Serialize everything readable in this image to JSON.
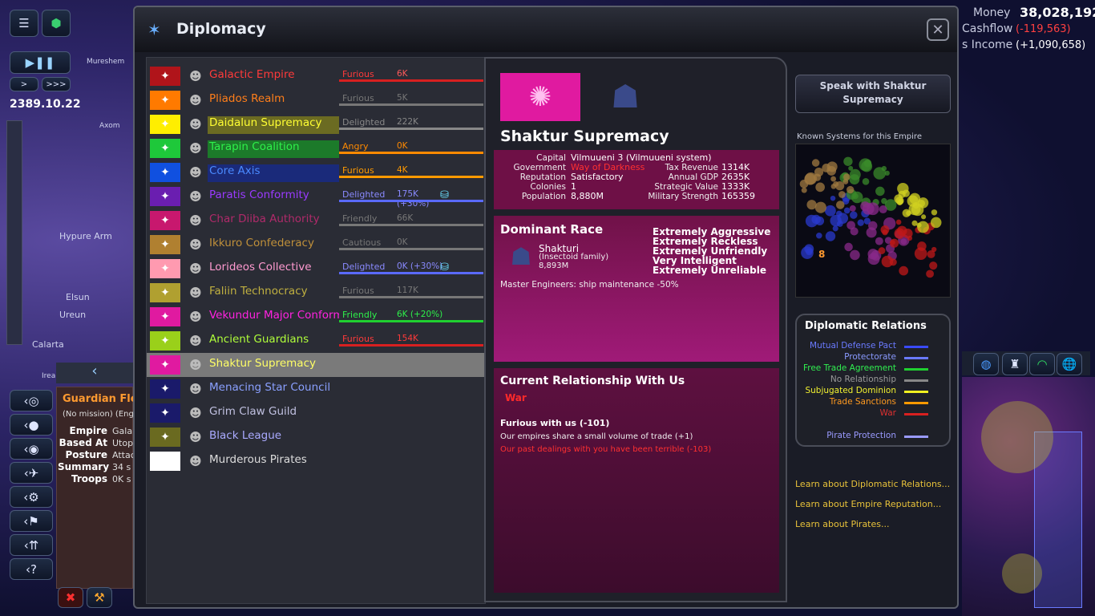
{
  "hud": {
    "date": "2389.10.22",
    "map_labels": [
      "Hypure Arm",
      "Calarta",
      "Elsun",
      "Ureun",
      "Mureshem",
      "Axom",
      "Ireab"
    ],
    "money_label": "Money",
    "money_value": "38,028,192",
    "cashflow_label": "Cashflow",
    "cashflow_value": "(-119,563)",
    "income_label": "s Income",
    "income_value": "(+1,090,658)",
    "speed_slow": ">",
    "speed_fast": ">>>"
  },
  "fleet": {
    "title": "Guardian Fle",
    "mission": "(No mission) (Eng",
    "rows": [
      {
        "label": "Empire",
        "value": "Gala"
      },
      {
        "label": "Based At",
        "value": "Utop"
      },
      {
        "label": "Posture",
        "value": "Attac"
      },
      {
        "label": "Summary",
        "value": "34 s"
      },
      {
        "label": "Troops",
        "value": "0K s"
      }
    ]
  },
  "window": {
    "title": "Diplomacy",
    "close": "✕"
  },
  "empires": [
    {
      "name": "Galactic Empire",
      "attitude": "Furious",
      "value": "6K",
      "flag_color": "#b0141a",
      "name_color": "#ff3a3a",
      "name_bg": "",
      "attitude_color": "#ff3a3a",
      "value_color": "#ff5a5a",
      "bar_color": "#d82020",
      "bar_width": 180,
      "trade": false
    },
    {
      "name": "Pliados Realm",
      "attitude": "Furious",
      "value": "5K",
      "flag_color": "#ff7a00",
      "name_color": "#ff7e1a",
      "name_bg": "",
      "attitude_color": "#777",
      "value_color": "#777",
      "bar_color": "#777",
      "bar_width": 180,
      "trade": false
    },
    {
      "name": "Daidalun Supremacy",
      "attitude": "Delighted",
      "value": "222K",
      "flag_color": "#ffee00",
      "name_color": "#ffff33",
      "name_bg": "#6b6b22",
      "attitude_color": "#888",
      "value_color": "#888",
      "bar_color": "#888",
      "bar_width": 180,
      "trade": false
    },
    {
      "name": "Tarapin Coalition",
      "attitude": "Angry",
      "value": "0K",
      "flag_color": "#1ec83a",
      "name_color": "#2ef04a",
      "name_bg": "#1c7a2a",
      "attitude_color": "#ff8a00",
      "value_color": "#ff8a00",
      "bar_color": "#ff8a00",
      "bar_width": 180,
      "trade": false
    },
    {
      "name": "Core Axis",
      "attitude": "Furious",
      "value": "4K",
      "flag_color": "#1050e0",
      "name_color": "#4a8aff",
      "name_bg": "#1a2a7a",
      "attitude_color": "#ff9a00",
      "value_color": "#ff9a00",
      "bar_color": "#ff9a00",
      "bar_width": 180,
      "trade": false
    },
    {
      "name": "Paratis Conformity",
      "attitude": "Delighted",
      "value": "175K (+30%)",
      "flag_color": "#6a1eb0",
      "name_color": "#9a3aff",
      "name_bg": "",
      "attitude_color": "#8a8aff",
      "value_color": "#8a8aff",
      "bar_color": "#5a6aff",
      "bar_width": 180,
      "trade": true
    },
    {
      "name": "Char Diiba Authority",
      "attitude": "Friendly",
      "value": "66K",
      "flag_color": "#c8186e",
      "name_color": "#b02a6a",
      "name_bg": "",
      "attitude_color": "#777",
      "value_color": "#777",
      "bar_color": "#777",
      "bar_width": 180,
      "trade": false
    },
    {
      "name": "Ikkuro Confederacy",
      "attitude": "Cautious",
      "value": "0K",
      "flag_color": "#b08030",
      "name_color": "#c0903a",
      "name_bg": "",
      "attitude_color": "#777",
      "value_color": "#777",
      "bar_color": "#777",
      "bar_width": 180,
      "trade": false
    },
    {
      "name": "Lorideos Collective",
      "attitude": "Delighted",
      "value": "0K (+30%)",
      "flag_color": "#ff9ab0",
      "name_color": "#ff9ad0",
      "name_bg": "",
      "attitude_color": "#8a8aff",
      "value_color": "#8a8aff",
      "bar_color": "#5a6aff",
      "bar_width": 180,
      "trade": true
    },
    {
      "name": "Faliin Technocracy",
      "attitude": "Furious",
      "value": "117K",
      "flag_color": "#b0a030",
      "name_color": "#c0b040",
      "name_bg": "",
      "attitude_color": "#777",
      "value_color": "#777",
      "bar_color": "#777",
      "bar_width": 180,
      "trade": false
    },
    {
      "name": "Vekundur Major Conformi",
      "attitude": "Friendly",
      "value": "6K (+20%)",
      "flag_color": "#e01aa0",
      "name_color": "#ff22e0",
      "name_bg": "",
      "attitude_color": "#2ef04a",
      "value_color": "#2ef04a",
      "bar_color": "#20d030",
      "bar_width": 180,
      "trade": false
    },
    {
      "name": "Ancient Guardians",
      "attitude": "Furious",
      "value": "154K",
      "flag_color": "#9ad01a",
      "name_color": "#b0ff3a",
      "name_bg": "",
      "attitude_color": "#ff3a3a",
      "value_color": "#ff3a3a",
      "bar_color": "#d82020",
      "bar_width": 180,
      "trade": false
    },
    {
      "name": "Shaktur Supremacy",
      "attitude": "",
      "value": "",
      "flag_color": "#e01aa0",
      "name_color": "#ffff66",
      "name_bg": "",
      "attitude_color": "#777",
      "value_color": "#777",
      "bar_color": "",
      "bar_width": 0,
      "trade": false,
      "selected": true
    },
    {
      "name": "Menacing Star Council",
      "attitude": "",
      "value": "",
      "flag_color": "#1a1a6a",
      "name_color": "#8aa0ff",
      "name_bg": "",
      "attitude_color": "#777",
      "value_color": "#777",
      "bar_color": "",
      "bar_width": 0,
      "trade": false
    },
    {
      "name": "Grim Claw Guild",
      "attitude": "",
      "value": "",
      "flag_color": "#1a1a6a",
      "name_color": "#c0c0e0",
      "name_bg": "",
      "attitude_color": "#777",
      "value_color": "#777",
      "bar_color": "",
      "bar_width": 0,
      "trade": false
    },
    {
      "name": "Black League",
      "attitude": "",
      "value": "",
      "flag_color": "#6a6a20",
      "name_color": "#aaaaff",
      "name_bg": "",
      "attitude_color": "#777",
      "value_color": "#777",
      "bar_color": "",
      "bar_width": 0,
      "trade": false
    },
    {
      "name": "Murderous Pirates",
      "attitude": "",
      "value": "",
      "flag_color": "#ffffff",
      "name_color": "#dddddd",
      "name_bg": "",
      "attitude_color": "#777",
      "value_color": "#777",
      "bar_color": "",
      "bar_width": 0,
      "trade": false
    }
  ],
  "detail": {
    "empire_name": "Shaktur Supremacy",
    "capital_label": "Capital",
    "capital_value": "Vilmuueni 3 (Vilmuueni system)",
    "government_label": "Government",
    "government_value": "Way of Darkness",
    "reputation_label": "Reputation",
    "reputation_value": "Satisfactory",
    "colonies_label": "Colonies",
    "colonies_value": "1",
    "population_label": "Population",
    "population_value": "8,880M",
    "tax_label": "Tax Revenue",
    "tax_value": "1314K",
    "gdp_label": "Annual GDP",
    "gdp_value": "2635K",
    "strategic_label": "Strategic Value",
    "strategic_value": "1333K",
    "military_label": "Military Strength",
    "military_value": "165359",
    "race_heading": "Dominant Race",
    "race_name": "Shakturi",
    "race_family": "(Insectoid family)",
    "race_pop": "8,893M",
    "traits": [
      "Extremely Aggressive",
      "Extremely Reckless",
      "Extremely Unfriendly",
      "Very Intelligent",
      "Extremely Unreliable"
    ],
    "race_bonus": "Master Engineers: ship maintenance -50%",
    "relation_heading": "Current Relationship With Us",
    "relation_status": "War",
    "mood": "Furious with us (-101)",
    "mood_items": [
      {
        "text": "Our empires share a small volume of trade (+1)",
        "color": "#f0f0f0"
      },
      {
        "text": "Our past dealings with you have been terrible (-103)",
        "color": "#ff3030"
      }
    ]
  },
  "right": {
    "speak_button": "Speak with Shaktur Supremacy",
    "known_systems_label": "Known Systems for this Empire",
    "relations_heading": "Diplomatic Relations",
    "legend": [
      {
        "label": "Mutual Defense Pact",
        "color": "#3a4aff",
        "text_color": "#6a7aff"
      },
      {
        "label": "Protectorate",
        "color": "#6a7aff",
        "text_color": "#8a9aff"
      },
      {
        "label": "Free Trade Agreement",
        "color": "#20d030",
        "text_color": "#30f050"
      },
      {
        "label": "No Relationship",
        "color": "#888888",
        "text_color": "#999999"
      },
      {
        "label": "Subjugated Dominion",
        "color": "#f0f020",
        "text_color": "#f0f030"
      },
      {
        "label": "Trade Sanctions",
        "color": "#ff9a00",
        "text_color": "#ff9a20"
      },
      {
        "label": "War",
        "color": "#d82020",
        "text_color": "#e03030"
      },
      {
        "label": "Pirate Protection",
        "color": "#9a9aff",
        "text_color": "#9a9aff"
      }
    ],
    "links": [
      "Learn about Diplomatic Relations...",
      "Learn about Empire Reputation...",
      "Learn about Pirates..."
    ],
    "minimap_marker": "8"
  }
}
